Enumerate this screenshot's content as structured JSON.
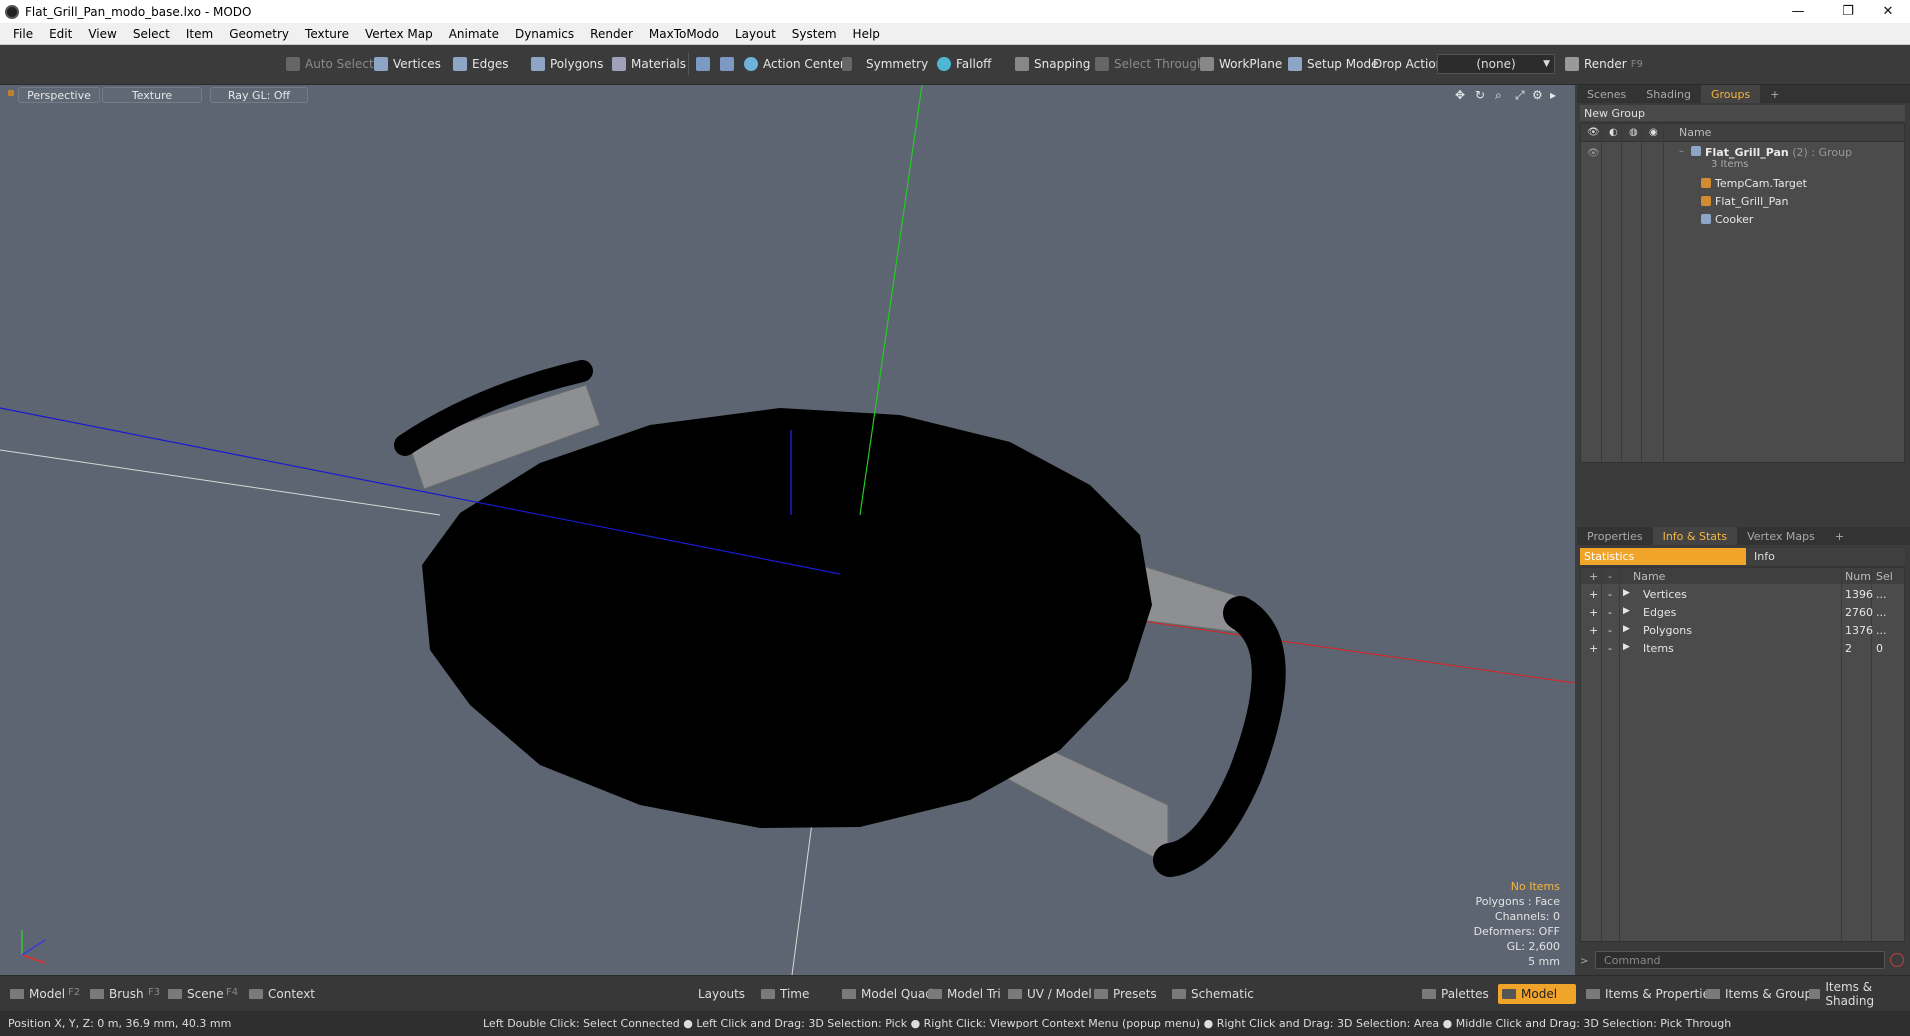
{
  "window": {
    "title": "Flat_Grill_Pan_modo_base.lxo - MODO",
    "controls": [
      "—",
      "❐",
      "✕"
    ]
  },
  "menu": [
    "File",
    "Edit",
    "View",
    "Select",
    "Item",
    "Geometry",
    "Texture",
    "Vertex Map",
    "Animate",
    "Dynamics",
    "Render",
    "MaxToModo",
    "Layout",
    "System",
    "Help"
  ],
  "toolbar": {
    "auto_select": "Auto Select",
    "vertices": "Vertices",
    "edges": "Edges",
    "polygons": "Polygons",
    "materials": "Materials",
    "action_center": "Action Center",
    "symmetry": "Symmetry",
    "falloff": "Falloff",
    "snapping": "Snapping",
    "select_through": "Select Through",
    "workplane": "WorkPlane",
    "setup_mode": "Setup Mode",
    "drop_action": "Drop Action",
    "drop_value": "(none)",
    "render": "Render",
    "render_key": "F9"
  },
  "viewport": {
    "tab_view": "Perspective",
    "tab_shading": "Texture",
    "tab_raygl": "Ray GL: Off",
    "info": {
      "items": "No Items",
      "polygons": "Polygons : Face",
      "channels": "Channels: 0",
      "deformers": "Deformers: OFF",
      "gl": "GL: 2,600",
      "scale": "5 mm"
    },
    "colors": {
      "background": "#5c6571",
      "x_axis": "#e02020",
      "y_axis": "#22cc22",
      "z_axis": "#1a1ad0"
    }
  },
  "groups_panel": {
    "tabs": [
      "Scenes",
      "Shading",
      "Groups"
    ],
    "active_tab": "Groups",
    "new_group": "New Group",
    "name_header": "Name",
    "group": {
      "name": "Flat_Grill_Pan",
      "count": "(2)",
      "type": ": Group",
      "items_label": "3 Items"
    },
    "children": [
      "TempCam.Target",
      "Flat_Grill_Pan",
      "Cooker"
    ]
  },
  "stats_panel": {
    "tabs": [
      "Properties",
      "Info & Stats",
      "Vertex Maps"
    ],
    "active_tab": "Info & Stats",
    "sub_tabs": [
      "Statistics",
      "Info"
    ],
    "headers": {
      "name": "Name",
      "num": "Num",
      "sel": "Sel"
    },
    "rows": [
      {
        "name": "Vertices",
        "num": "1396",
        "sel": "..."
      },
      {
        "name": "Edges",
        "num": "2760",
        "sel": "..."
      },
      {
        "name": "Polygons",
        "num": "1376",
        "sel": "..."
      },
      {
        "name": "Items",
        "num": "2",
        "sel": "0"
      }
    ],
    "command_placeholder": "Command"
  },
  "bottom_bar": {
    "model": "Model",
    "model_key": "F2",
    "brush": "Brush",
    "brush_key": "F3",
    "scene": "Scene",
    "scene_key": "F4",
    "context": "Context",
    "layouts": "Layouts",
    "time": "Time",
    "model_quad": "Model Quad",
    "model_tri": "Model Tri",
    "uv_model": "UV / Model",
    "presets": "Presets",
    "schematic": "Schematic",
    "palettes": "Palettes",
    "model_active": "Model",
    "items_props": "Items & Properties",
    "items_groups": "Items & Groups",
    "items_shading": "Items & Shading"
  },
  "status": {
    "position": "Position X, Y, Z:  0 m, 36.9 mm, 40.3 mm",
    "hint": "Left Double Click: Select Connected ● Left Click and Drag: 3D Selection: Pick ● Right Click: Viewport Context Menu (popup menu) ● Right Click and Drag: 3D Selection: Area ● Middle Click and Drag: 3D Selection: Pick Through"
  }
}
